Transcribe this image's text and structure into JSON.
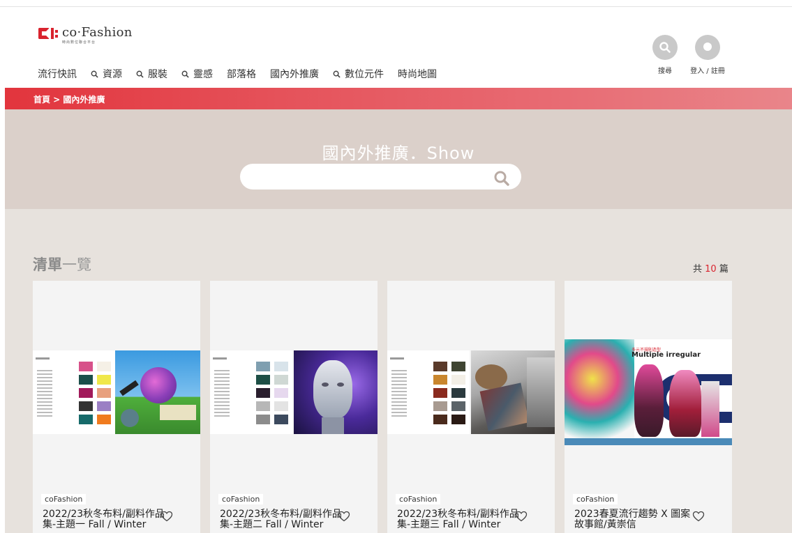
{
  "header": {
    "logo_name": "co·Fashion",
    "logo_sub": "時尚數位聯合平台",
    "nav": [
      {
        "label": "流行快訊",
        "has_icon": false
      },
      {
        "label": "資源",
        "has_icon": true
      },
      {
        "label": "服裝",
        "has_icon": true
      },
      {
        "label": "靈感",
        "has_icon": true
      },
      {
        "label": "部落格",
        "has_icon": false
      },
      {
        "label": "國內外推廣",
        "has_icon": false
      },
      {
        "label": "數位元件",
        "has_icon": true
      },
      {
        "label": "時尚地圖",
        "has_icon": false
      }
    ],
    "search_label": "搜尋",
    "login_label": "登入 / 註冊"
  },
  "breadcrumb": "首頁 > 國內外推廣",
  "hero": {
    "title": "國內外推廣．Show",
    "search_placeholder": ""
  },
  "list": {
    "title_bold": "清單",
    "title_rest": "一覽",
    "count_prefix": "共",
    "count": "10",
    "count_suffix": "篇"
  },
  "cards": [
    {
      "tag": "coFashion",
      "title": "2022/23秋冬布料/副料作品集-主題一 Fall / Winter"
    },
    {
      "tag": "coFashion",
      "title": "2022/23秋冬布料/副料作品集-主題二 Fall / Winter"
    },
    {
      "tag": "coFashion",
      "title": "2022/23秋冬布料/副料作品集-主題三 Fall / Winter"
    },
    {
      "tag": "coFashion",
      "title": "2023春夏流行趨勢 X 圖案故事館/黃崇信",
      "poster_title": "多元不規則造型",
      "poster_sub": "Multiple irregular"
    }
  ],
  "colors": {
    "brand_red": "#d9232e",
    "hero_bg": "#dbd0ca",
    "list_bg": "#e7e2dd"
  }
}
